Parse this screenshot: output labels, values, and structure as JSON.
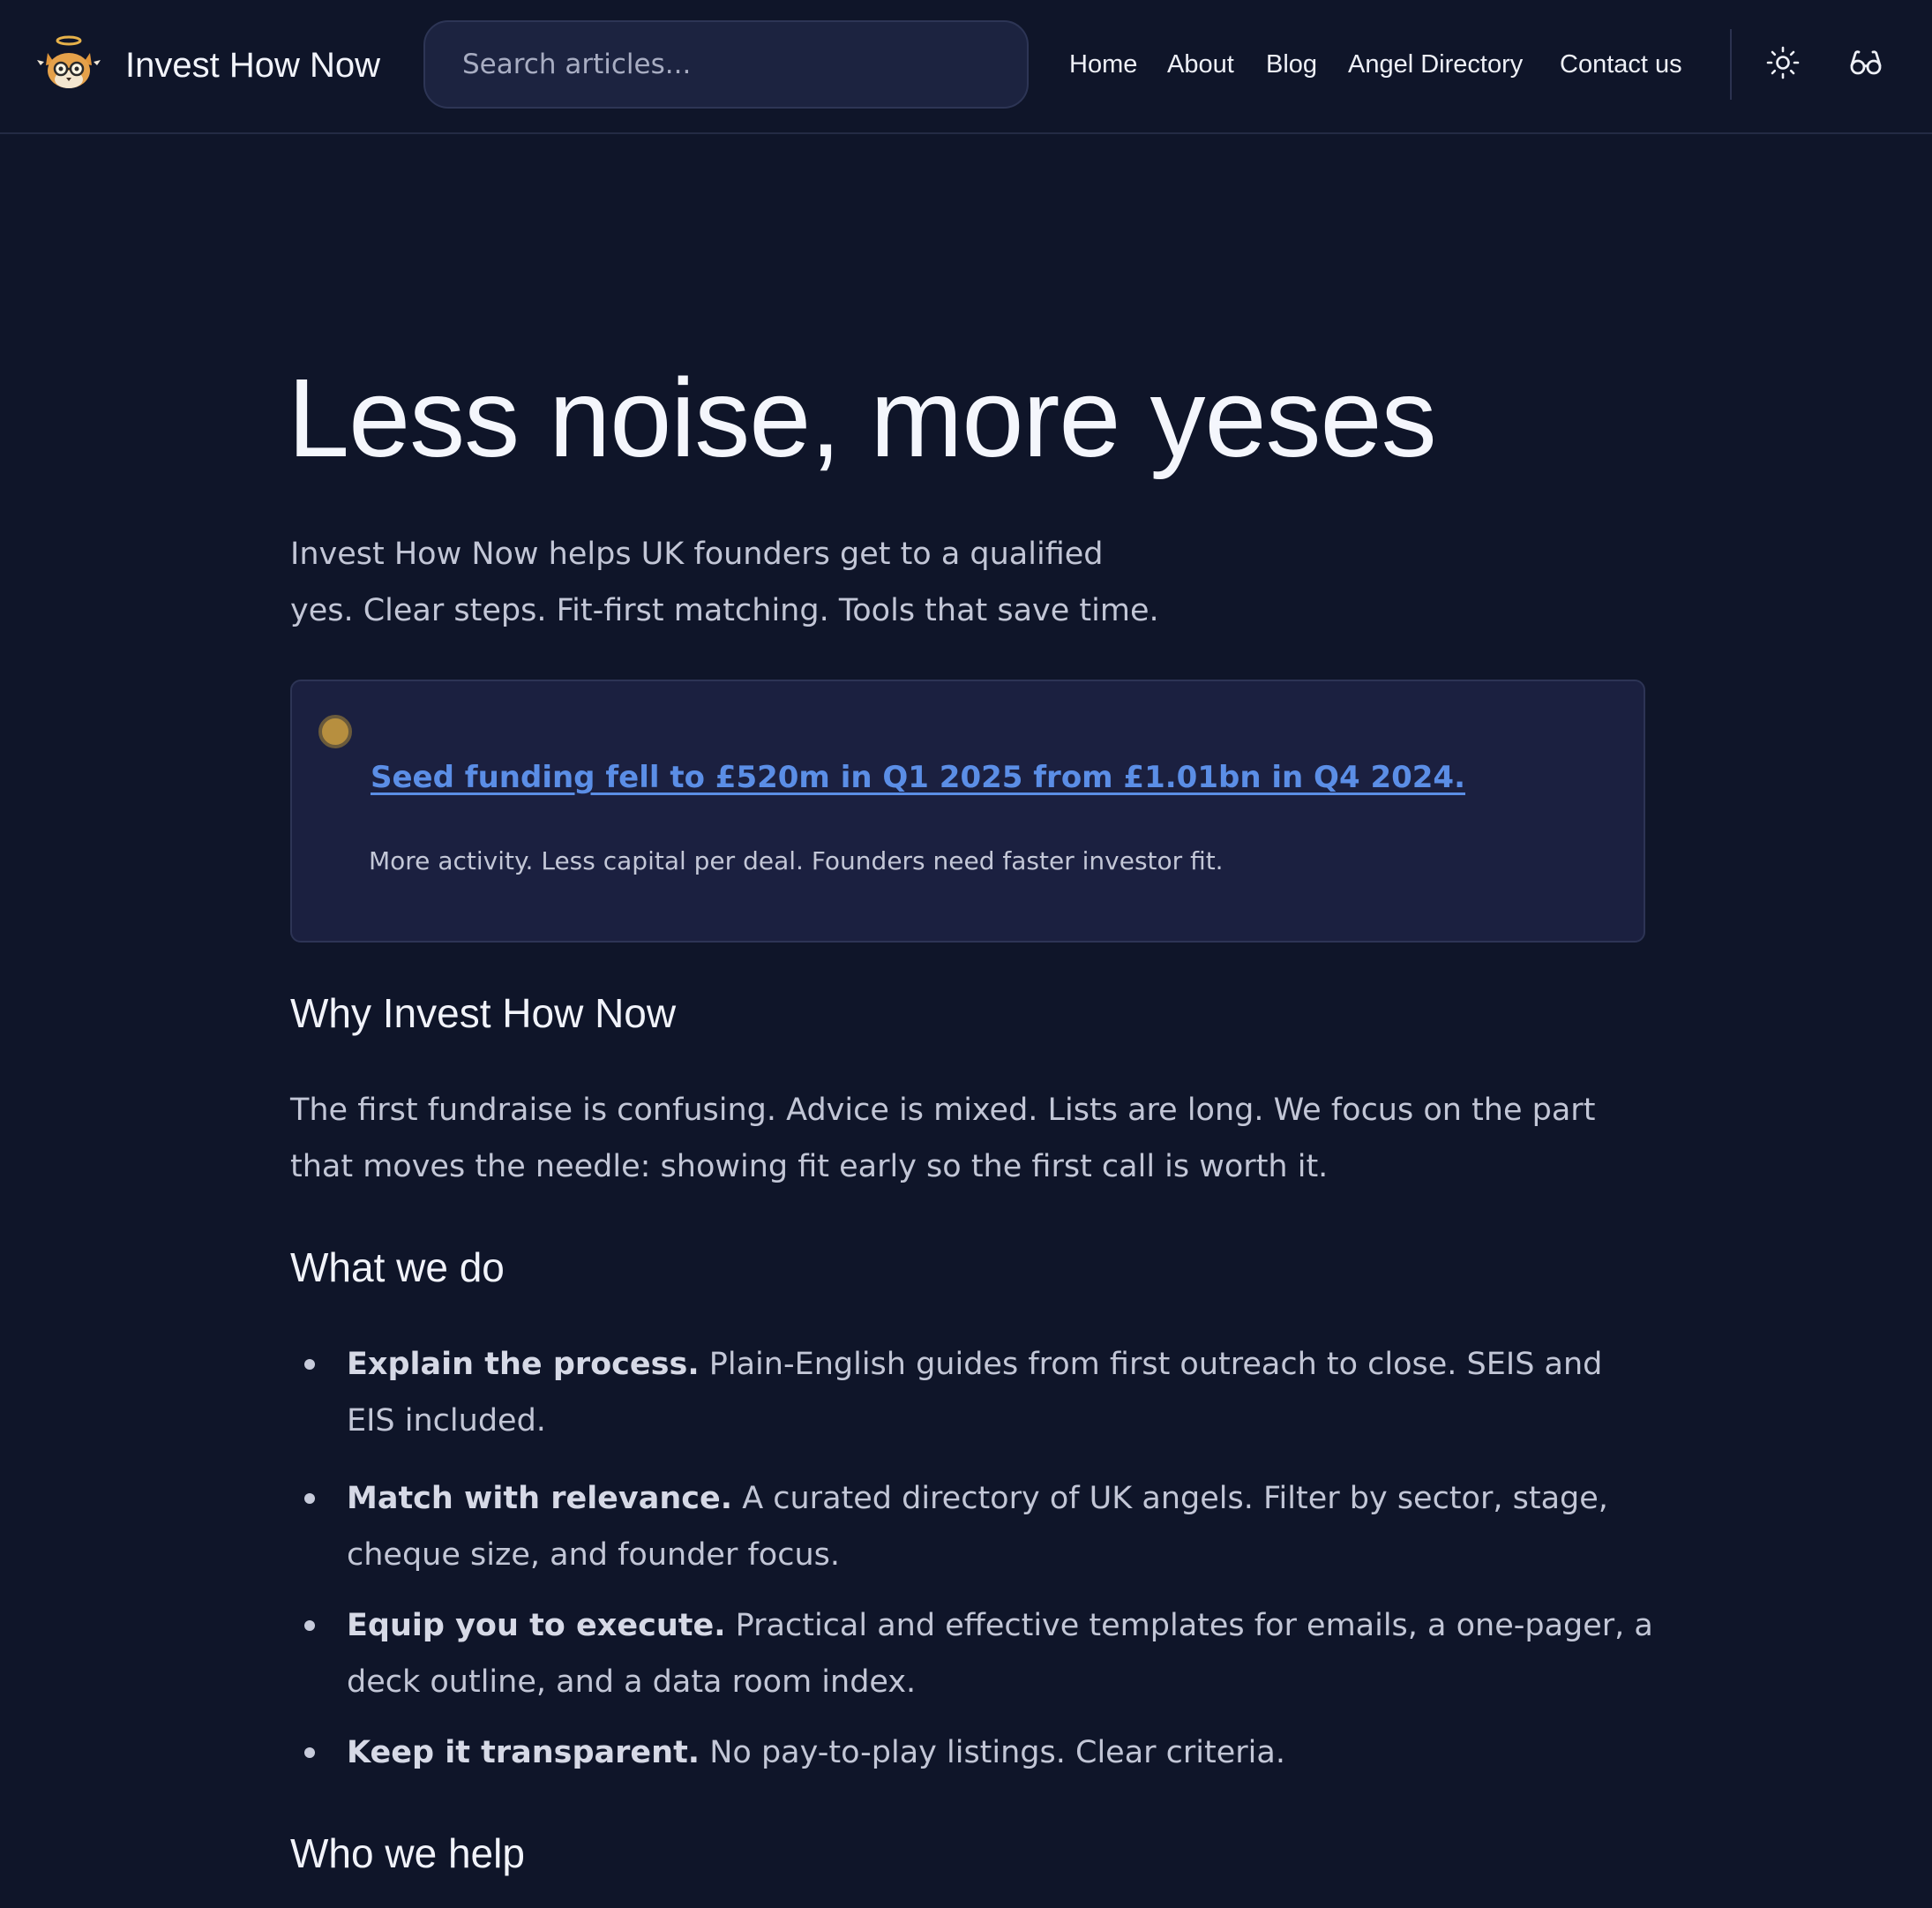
{
  "header": {
    "brand": "Invest How Now",
    "search_placeholder": "Search articles...",
    "nav": {
      "home": "Home",
      "about": "About",
      "blog": "Blog",
      "angels": "Angel Directory",
      "contact": "Contact us"
    },
    "icons": [
      "sun-icon",
      "glasses-icon"
    ]
  },
  "hero": {
    "title": "Less noise, more yeses",
    "intro_line1": "Invest How Now helps UK founders get to a qualified",
    "intro_line2": "yes. Clear steps. Fit-first matching. Tools that save time."
  },
  "callout": {
    "link": "Seed funding fell to £520m in Q1 2025 from £1.01bn in Q4 2024.",
    "sub": "More activity. Less capital per deal. Founders need faster investor fit."
  },
  "why": {
    "heading": "Why Invest How Now",
    "line1": "The first fundraise is confusing. Advice is mixed. Lists are long. We focus on the part",
    "line2": "that moves the needle: showing fit early so the first call is worth it."
  },
  "what": {
    "heading": "What we do",
    "items": [
      {
        "bold": "Explain the process.",
        "line1": " Plain-English guides from first outreach to close. SEIS and",
        "line2": "EIS included."
      },
      {
        "bold": "Match with relevance.",
        "line1": " A curated directory of UK angels. Filter by sector, stage,",
        "line2": "cheque size, and founder focus."
      },
      {
        "bold": "Equip you to execute.",
        "line1": " Practical and effective templates for emails, a one-pager, a",
        "line2": "deck outline, and a data room index."
      },
      {
        "bold": "Keep it transparent.",
        "line1": " No pay-to-play listings. Clear criteria.",
        "line2": ""
      }
    ]
  },
  "who": {
    "heading": "Who we help"
  },
  "colors": {
    "background": "#0f1529",
    "callout_bg": "#1b2040",
    "link": "#5b8ee6",
    "accent_dot": "#b78f3f"
  }
}
